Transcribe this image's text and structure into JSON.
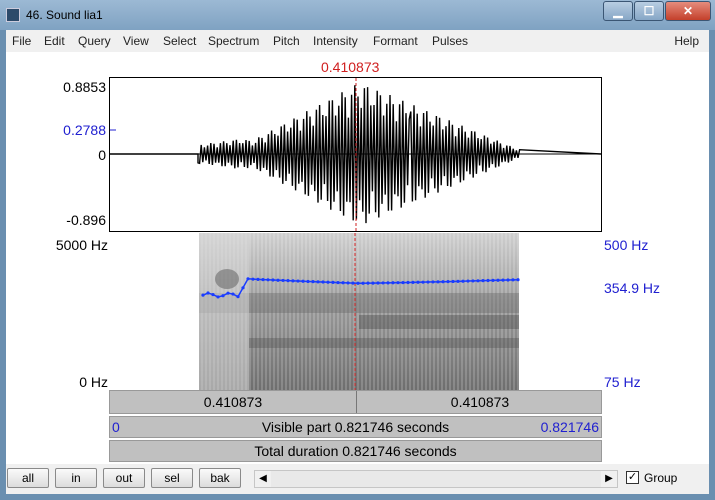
{
  "window": {
    "title": "46. Sound lia1",
    "minimize_glyph": "▁",
    "maximize_glyph": "☐",
    "close_glyph": "✕"
  },
  "menu": {
    "items": [
      "File",
      "Edit",
      "Query",
      "View",
      "Select",
      "Spectrum",
      "Pitch",
      "Intensity",
      "Formant",
      "Pulses"
    ],
    "help": "Help"
  },
  "cursor": {
    "time_label": "0.410873"
  },
  "waveform": {
    "amp_max": "0.8853",
    "amp_cursor": "0.2788",
    "amp_zero": "0",
    "amp_min": "-0.896"
  },
  "spectrogram": {
    "freq_top": "5000 Hz",
    "freq_bottom": "0 Hz",
    "pitch_top": "500 Hz",
    "pitch_value": "354.9 Hz",
    "pitch_bottom": "75 Hz"
  },
  "time_bar": {
    "left_part": "0.410873",
    "right_part": "0.410873"
  },
  "visible_bar": {
    "start": "0",
    "label": "Visible part 0.821746 seconds",
    "end": "0.821746"
  },
  "total_bar": {
    "label": "Total duration 0.821746 seconds"
  },
  "nav": {
    "all": "all",
    "in": "in",
    "out": "out",
    "sel": "sel",
    "bak": "bak",
    "scroll_left": "◀",
    "scroll_right": "▶"
  },
  "group": {
    "checked_mark": "✓",
    "label": "Group"
  },
  "colors": {
    "cursor_red": "#d02020",
    "pitch_blue": "#2020d0",
    "pitch_track": "#1a3cff"
  }
}
